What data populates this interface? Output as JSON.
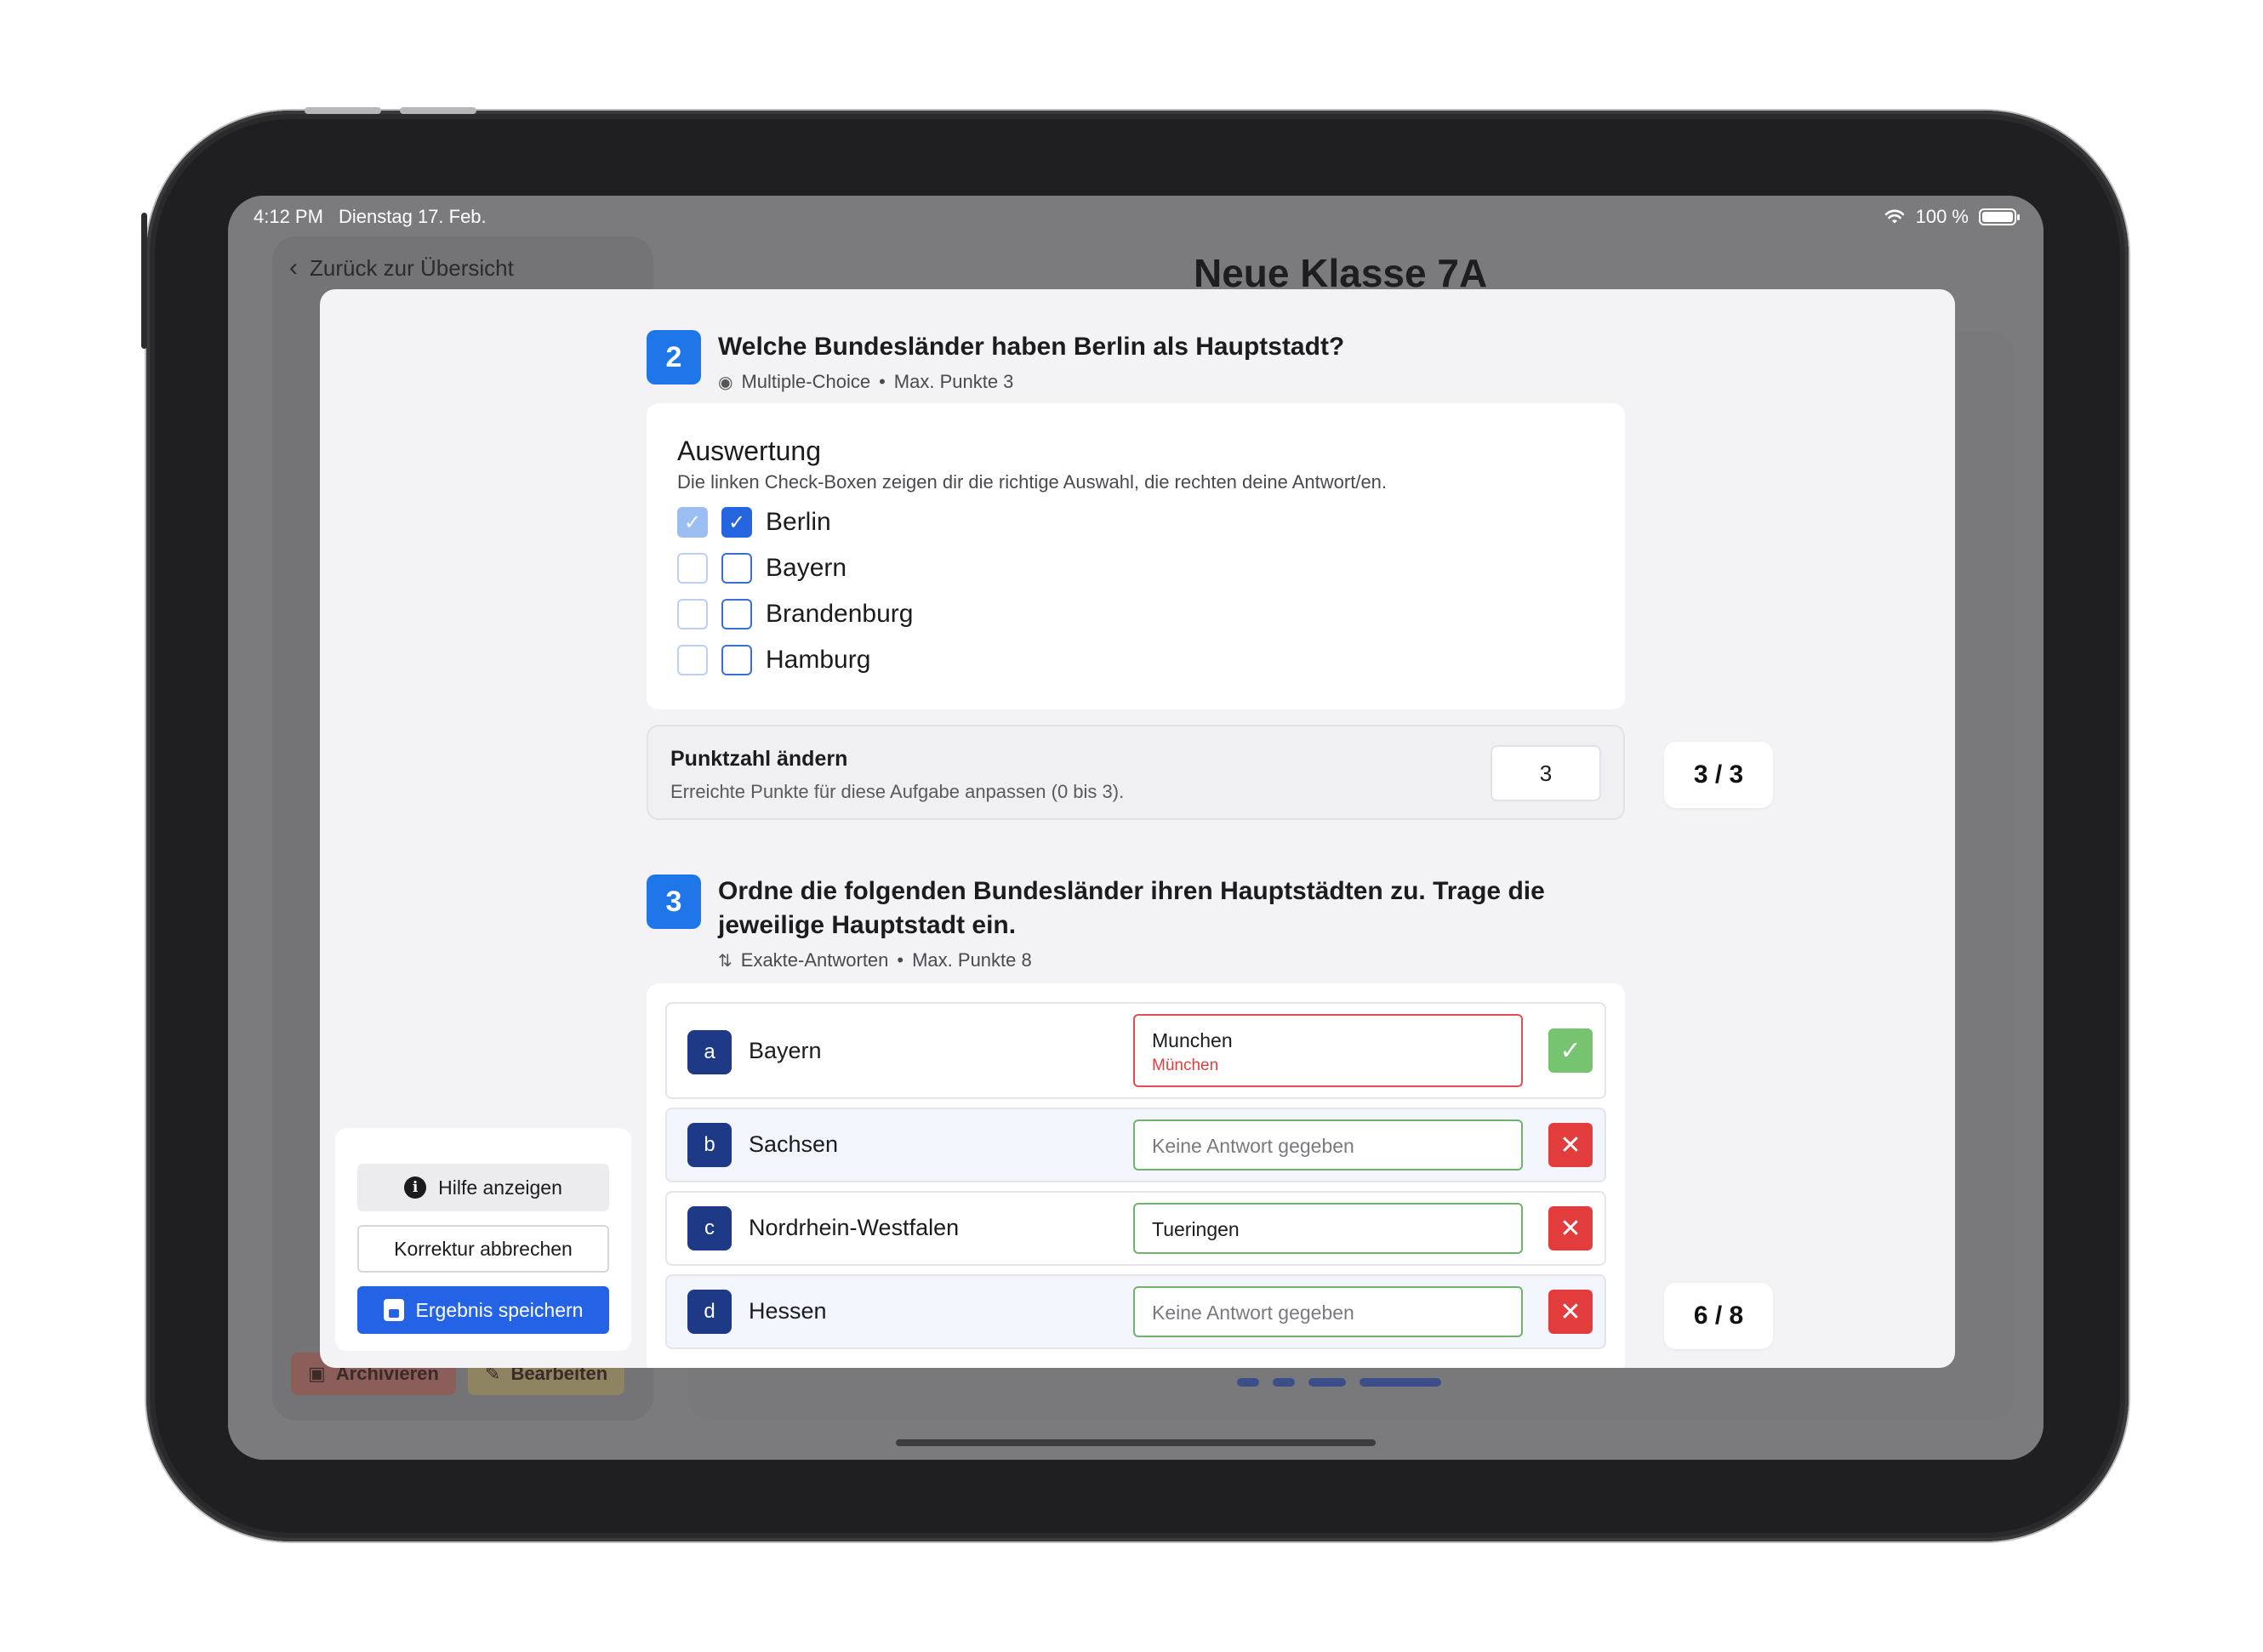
{
  "status_bar": {
    "time": "4:12 PM",
    "date": "Dienstag 17. Feb.",
    "wifi_icon": "wifi-icon",
    "battery": "100 %"
  },
  "background": {
    "back_link": "Zurück zur Übersicht",
    "page_title": "Neue Klasse 7A",
    "archive_button": "Archivieren",
    "edit_button": "Bearbeiten"
  },
  "question2": {
    "number": "2",
    "title": "Welche Bundesländer haben Berlin als Hauptstadt?",
    "type": "Multiple-Choice",
    "separator": "•",
    "max_points": "Max. Punkte 3",
    "evaluation": {
      "title": "Auswertung",
      "description": "Die linken Check-Boxen zeigen dir die richtige Auswahl, die rechten deine Antwort/en.",
      "options": [
        {
          "label": "Berlin",
          "correct": true,
          "selected": true
        },
        {
          "label": "Bayern",
          "correct": false,
          "selected": false
        },
        {
          "label": "Brandenburg",
          "correct": false,
          "selected": false
        },
        {
          "label": "Hamburg",
          "correct": false,
          "selected": false
        }
      ]
    },
    "points_override": {
      "title": "Punktzahl ändern",
      "description": "Erreichte Punkte für diese Aufgabe anpassen (0 bis 3).",
      "value": "3"
    },
    "score": "3 / 3"
  },
  "question3": {
    "number": "3",
    "title": "Ordne die folgenden Bundesländer ihren Hauptstädten zu. Trage die jeweilige Hauptstadt ein.",
    "type": "Exakte-Antworten",
    "separator": "•",
    "max_points": "Max. Punkte 8",
    "rows": [
      {
        "letter": "a",
        "state": "Bayern",
        "answer": "Munchen",
        "correction": "München",
        "placeholder": false,
        "result": "correct"
      },
      {
        "letter": "b",
        "state": "Sachsen",
        "answer": "Keine Antwort gegeben",
        "correction": "",
        "placeholder": true,
        "result": "wrong"
      },
      {
        "letter": "c",
        "state": "Nordrhein-Westfalen",
        "answer": "Tueringen",
        "correction": "",
        "placeholder": false,
        "result": "wrong"
      },
      {
        "letter": "d",
        "state": "Hessen",
        "answer": "Keine Antwort gegeben",
        "correction": "",
        "placeholder": true,
        "result": "wrong"
      }
    ],
    "score": "6 / 8"
  },
  "actions": {
    "help": "Hilfe anzeigen",
    "cancel": "Korrektur abbrechen",
    "save": "Ergebnis speichern"
  },
  "colors": {
    "accent_blue": "#1f76e8",
    "save_blue": "#2463e6",
    "letter_navy": "#1e3a86",
    "correct_green": "#76c370",
    "wrong_red": "#e23c3c"
  }
}
